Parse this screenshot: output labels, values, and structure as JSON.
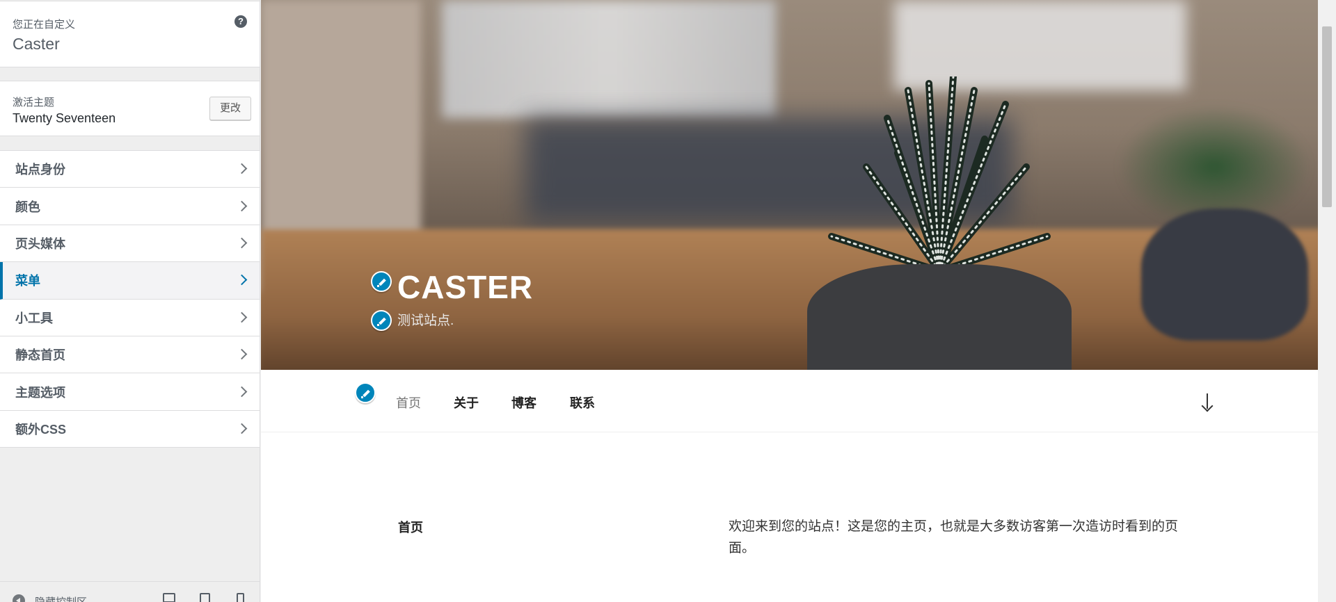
{
  "sidebar": {
    "customizing_label": "您正在自定义",
    "site_name": "Caster",
    "help_icon": "question-icon",
    "active_theme_label": "激活主题",
    "theme_name": "Twenty Seventeen",
    "change_button": "更改",
    "items": [
      {
        "label": "站点身份",
        "active": false
      },
      {
        "label": "颜色",
        "active": false
      },
      {
        "label": "页头媒体",
        "active": false
      },
      {
        "label": "菜单",
        "active": true
      },
      {
        "label": "小工具",
        "active": false
      },
      {
        "label": "静态首页",
        "active": false
      },
      {
        "label": "主题选项",
        "active": false
      },
      {
        "label": "额外CSS",
        "active": false
      }
    ],
    "footer": {
      "hide_controls_label": "隐藏控制区"
    }
  },
  "preview": {
    "site_title": "CASTER",
    "site_description": "测试站点.",
    "nav": [
      "首页",
      "关于",
      "博客",
      "联系"
    ],
    "content": {
      "title": "首页",
      "body": "欢迎来到您的站点！这是您的主页，也就是大多数访客第一次造访时看到的页面。"
    }
  },
  "colors": {
    "accent": "#0073aa",
    "edit_shortcut": "#0085ba"
  }
}
